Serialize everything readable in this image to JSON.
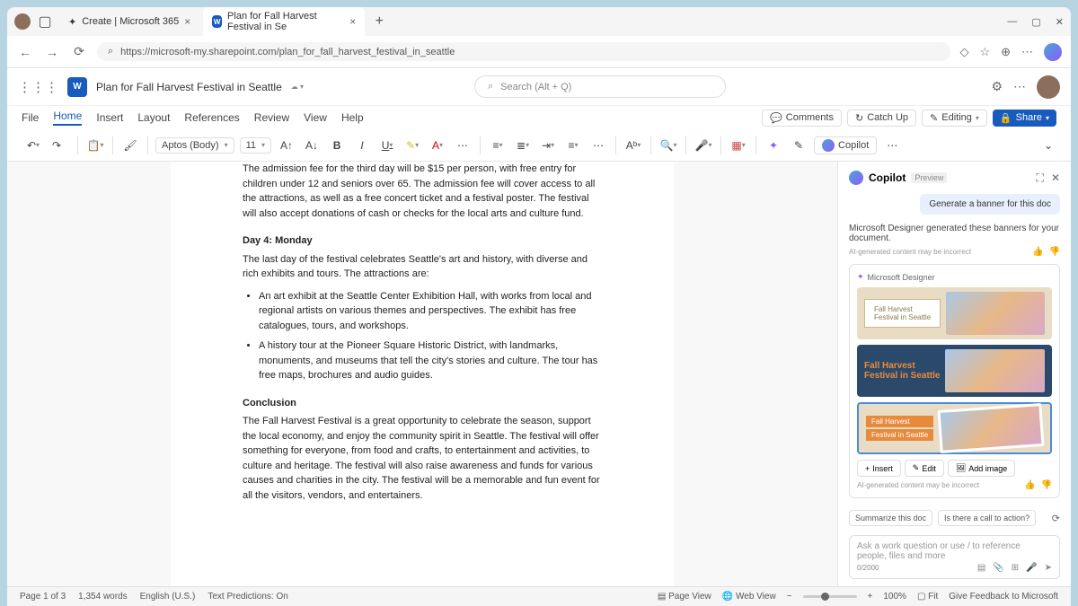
{
  "browser": {
    "tab1": "Create | Microsoft 365",
    "tab2": "Plan for Fall Harvest Festival in Se",
    "url": "https://microsoft-my.sharepoint.com/plan_for_fall_harvest_festival_in_seattle"
  },
  "app": {
    "word_icon": "W",
    "doc_title": "Plan for Fall Harvest Festival in Seattle",
    "search_placeholder": "Search (Alt + Q)"
  },
  "ribbon": {
    "tabs": {
      "file": "File",
      "home": "Home",
      "insert": "Insert",
      "layout": "Layout",
      "references": "References",
      "review": "Review",
      "view": "View",
      "help": "Help"
    },
    "actions": {
      "comments": "Comments",
      "catchup": "Catch Up",
      "editing": "Editing",
      "share": "Share"
    }
  },
  "toolbar": {
    "font": "Aptos (Body)",
    "size": "11",
    "copilot": "Copilot"
  },
  "document": {
    "intro_partial": "The admission fee for the third day will be $15 per person, with free entry for children under 12 and seniors over 65. The admission fee will cover access to all the attractions, as well as a free concert ticket and a festival poster. The festival will also accept donations of cash or checks for the local arts and culture fund.",
    "day4_heading": "Day 4: Monday",
    "day4_intro": "The last day of the festival celebrates Seattle's art and history, with diverse and rich exhibits and tours. The attractions are:",
    "bullet1": "An art exhibit at the Seattle Center Exhibition Hall, with works from local and regional artists on various themes and perspectives. The exhibit has free catalogues, tours, and workshops.",
    "bullet2": "A history tour at the Pioneer Square Historic District, with landmarks, monuments, and museums that tell the city's stories and culture. The tour has free maps, brochures and audio guides.",
    "conclusion_heading": "Conclusion",
    "conclusion_body": "The Fall Harvest Festival is a great opportunity to celebrate the season, support the local economy, and enjoy the community spirit in Seattle. The festival will offer something for everyone, from food and crafts, to entertainment and activities, to culture and heritage. The festival will also raise awareness and funds for various causes and charities in the city. The festival will be a memorable and fun event for all the visitors, vendors, and entertainers."
  },
  "copilot": {
    "title": "Copilot",
    "preview": "Preview",
    "prompt": "Generate a banner for this doc",
    "response": "Microsoft Designer generated these banners for your document.",
    "warning": "AI-generated content may be incorrect",
    "source": "Microsoft Designer",
    "banner_text_a": "Fall Harvest",
    "banner_text_b": "Festival in Seattle",
    "actions": {
      "insert": "Insert",
      "edit": "Edit",
      "add_image": "Add image"
    },
    "suggestions": {
      "summarize": "Summarize this doc",
      "cta": "Is there a call to action?"
    },
    "input_placeholder": "Ask a work question or use / to reference people, files and more",
    "char_count": "0/2000"
  },
  "status": {
    "page": "Page 1 of 3",
    "words": "1,354 words",
    "lang": "English (U.S.)",
    "predictions": "Text Predictions: On",
    "page_view": "Page View",
    "web_view": "Web View",
    "zoom": "100%",
    "fit": "Fit",
    "feedback": "Give Feedback to Microsoft"
  }
}
